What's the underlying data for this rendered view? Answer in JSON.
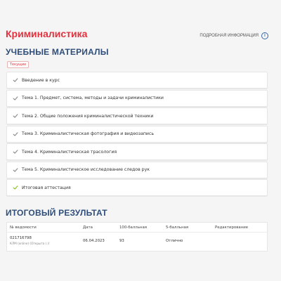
{
  "course": {
    "title": "Криминалистика",
    "more_info_label": "ПОДРОБНАЯ ИНФОРМАЦИЯ",
    "info_icon": "info-circle-icon"
  },
  "materials": {
    "heading": "УЧЕБНЫЕ МАТЕРИАЛЫ",
    "current_tab": "Текущие",
    "items": [
      {
        "label": "Введение в курс",
        "status": "done",
        "check_color": "#8a8a8a"
      },
      {
        "label": "Тема 1. Предмет, система, методы и задачи криминалистики",
        "status": "done",
        "check_color": "#8a8a8a"
      },
      {
        "label": "Тема 2. Общие положения криминалистической техники",
        "status": "done",
        "check_color": "#8a8a8a"
      },
      {
        "label": "Тема 3. Криминалистическая фотография и видеозапись",
        "status": "done",
        "check_color": "#8a8a8a"
      },
      {
        "label": "Тема 4. Криминалистическая трасология",
        "status": "done",
        "check_color": "#8a8a8a"
      },
      {
        "label": "Тема 5. Криминалистическое исследование следов рук",
        "status": "done",
        "check_color": "#8a8a8a"
      },
      {
        "label": "Итоговая аттестация",
        "status": "passed",
        "check_color": "#8bbf1f"
      }
    ]
  },
  "result": {
    "heading": "ИТОГОВЫЙ РЕЗУЛЬТАТ",
    "columns": [
      "№ ведомости",
      "Дата",
      "100-балльная",
      "5-балльная",
      "Редактирование"
    ],
    "rows": [
      {
        "sheet_number": "021716798",
        "sheet_info": "КЛМ (online) (Открыта ) //",
        "date": "06.04.2023",
        "score_100": "93",
        "score_5": "Отлично",
        "edit": ""
      }
    ]
  },
  "colors": {
    "brand_red": "#e2323f",
    "heading_blue": "#2f4e7a",
    "check_gray": "#8a8a8a",
    "check_green": "#8bbf1f"
  }
}
